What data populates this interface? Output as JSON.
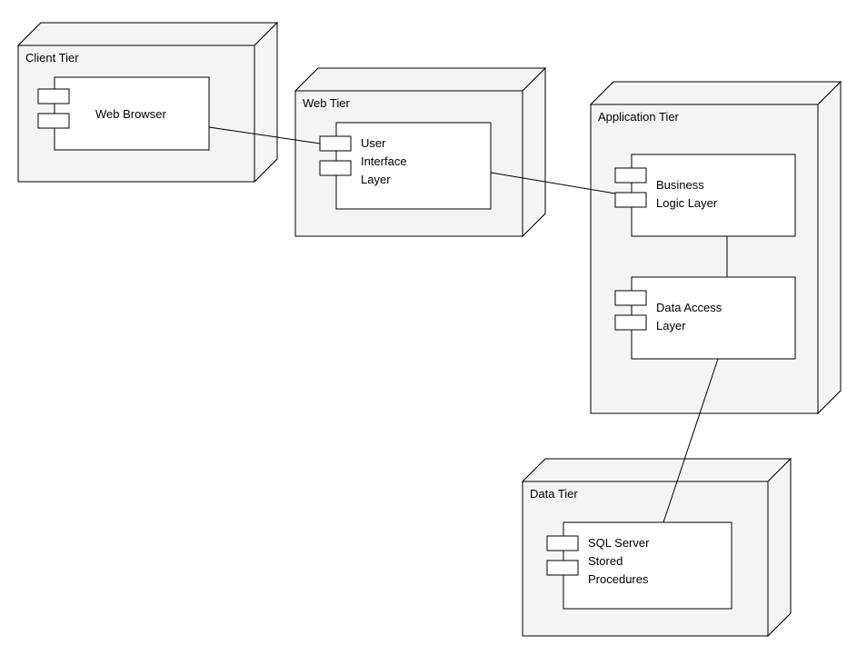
{
  "tiers": {
    "client": {
      "label": "Client Tier",
      "component": {
        "label": "Web Browser"
      }
    },
    "web": {
      "label": "Web Tier",
      "component": {
        "label_line1": "User",
        "label_line2": "Interface",
        "label_line3": "Layer"
      }
    },
    "app": {
      "label": "Application Tier",
      "component_a": {
        "label_line1": "Business",
        "label_line2": "Logic Layer"
      },
      "component_b": {
        "label_line1": "Data Access",
        "label_line2": "Layer"
      }
    },
    "data": {
      "label": "Data Tier",
      "component": {
        "label_line1": "SQL Server",
        "label_line2": "Stored",
        "label_line3": "Procedures"
      }
    }
  }
}
